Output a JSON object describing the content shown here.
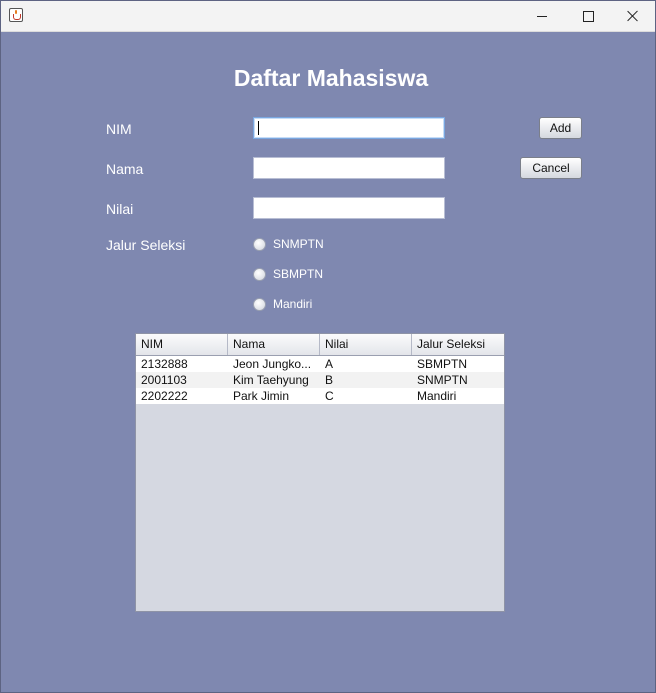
{
  "titlebar": {
    "app_icon": "java-cup-icon",
    "controls": [
      "minimize-icon",
      "maximize-icon",
      "close-icon"
    ]
  },
  "form": {
    "title": "Daftar Mahasiswa",
    "labels": {
      "nim": "NIM",
      "nama": "Nama",
      "nilai": "Nilai",
      "jalur": "Jalur Seleksi"
    },
    "values": {
      "nim": "",
      "nama": "",
      "nilai": ""
    },
    "radio_options": [
      "SNMPTN",
      "SBMPTN",
      "Mandiri"
    ],
    "buttons": {
      "add": "Add",
      "cancel": "Cancel"
    }
  },
  "table": {
    "columns": [
      "NIM",
      "Nama",
      "Nilai",
      "Jalur Seleksi"
    ],
    "rows": [
      [
        "2132888",
        "Jeon Jungko...",
        "A",
        "SBMPTN"
      ],
      [
        "2001103",
        "Kim Taehyung",
        "B",
        "SNMPTN"
      ],
      [
        "2202222",
        "Park Jimin",
        "C",
        "Mandiri"
      ]
    ]
  },
  "colors": {
    "background": "#7f88b0",
    "table_empty_area": "#d5d8e1",
    "titlebar": "#f3f3f3"
  }
}
